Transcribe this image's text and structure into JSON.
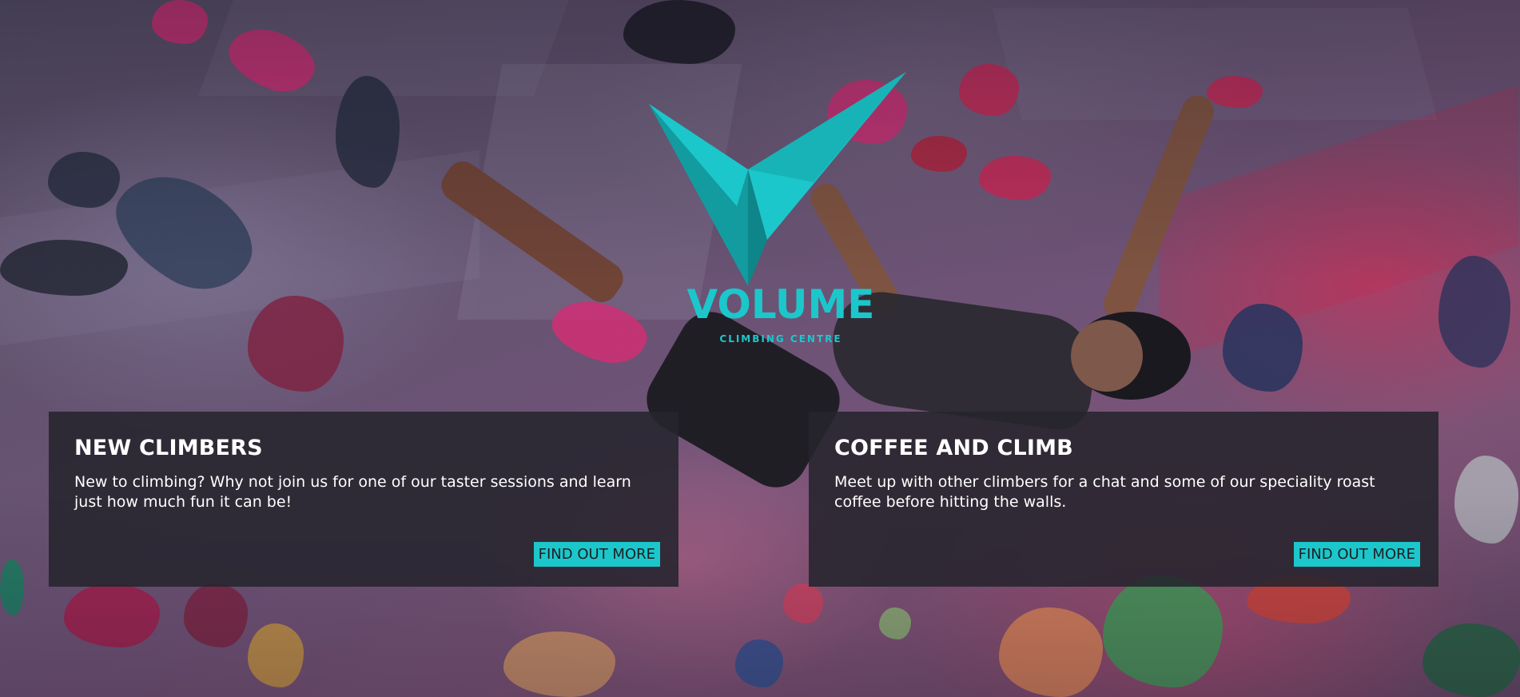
{
  "brand": {
    "name": "VOLUME",
    "tagline": "CLIMBING CENTRE",
    "accent_color": "#1cc7cb",
    "logo_icon": "v-chevron-logo-icon"
  },
  "hero": {
    "background": "climbing-wall-photo"
  },
  "cards": [
    {
      "title": "NEW CLIMBERS",
      "text": "New to climbing? Why not join us for one of our taster sessions and learn just how much fun it can be!",
      "button_label": "FIND OUT MORE"
    },
    {
      "title": "COFFEE AND CLIMB",
      "text": "Meet up with other climbers for a chat and some of our speciality roast coffee before hitting the walls.",
      "button_label": "FIND OUT MORE"
    }
  ]
}
